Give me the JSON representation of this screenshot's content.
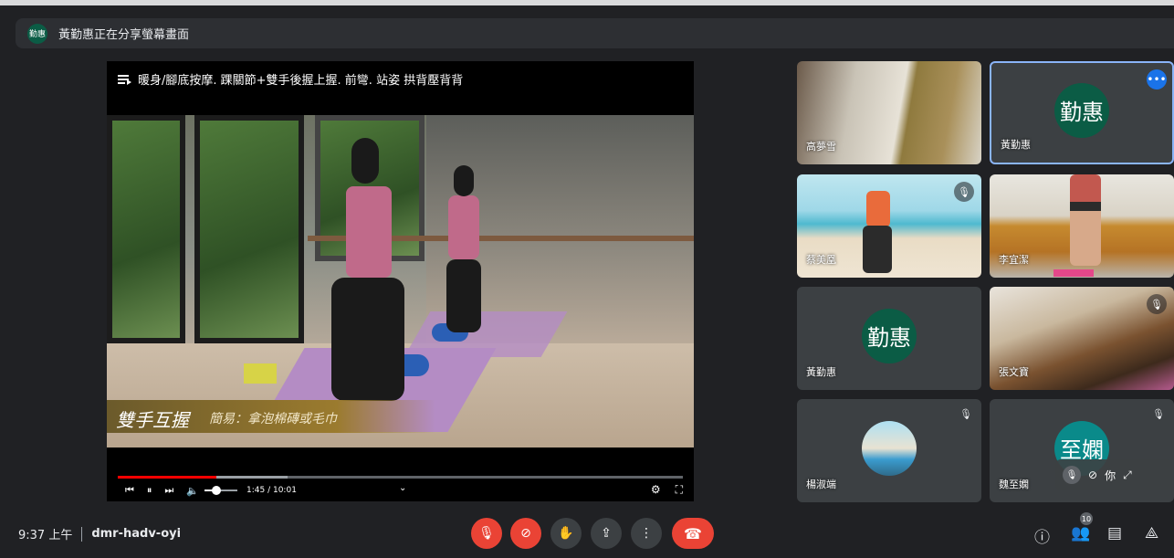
{
  "banner": {
    "avatar_text": "勤惠",
    "text": "黃勤惠正在分享螢幕畫面"
  },
  "presentation": {
    "title": "暖身/腳底按摩. 踝關節+雙手後握上握. 前彎. 站姿 拱背壓背背",
    "caption_main": "雙手互握",
    "caption_sub": "簡易：拿泡棉磚或毛巾",
    "time": "1:45 / 10:01",
    "progress": 0.175,
    "buffered": 0.3,
    "volume": 0.35,
    "icons": [
      "playlist-icon",
      "previous-icon",
      "pause-icon",
      "next-icon",
      "volume-icon",
      "chevron-down-icon",
      "settings-icon",
      "exit-fullscreen-icon"
    ]
  },
  "participants": [
    {
      "name": "高夢雪",
      "type": "video",
      "muted": false
    },
    {
      "name": "黃勤惠",
      "type": "avatar",
      "avatar_text": "勤惠",
      "avatar_color": "#0b5c45",
      "active": true,
      "more": true
    },
    {
      "name": "蔡美凰",
      "type": "video",
      "muted": true
    },
    {
      "name": "李宜潔",
      "type": "video",
      "muted": false
    },
    {
      "name": "黃勤惠",
      "type": "avatar",
      "avatar_text": "勤惠",
      "avatar_color": "#0b5c45",
      "muted": false
    },
    {
      "name": "張文寶",
      "type": "video",
      "muted": true
    },
    {
      "name": "楊淑端",
      "type": "photo",
      "muted": true
    },
    {
      "name": "魏至嫻",
      "type": "avatar",
      "avatar_text": "至嫻",
      "avatar_color": "#0a8a8a",
      "muted": true,
      "self": true,
      "self_label": "你"
    }
  ],
  "bottom_bar": {
    "time": "9:37 上午",
    "meeting_code": "dmr-hadv-oyi",
    "people_count": "10"
  },
  "colors": {
    "background": "#202124",
    "danger": "#ea4335",
    "accent": "#8ab4f8",
    "more_blue": "#1a73e8"
  }
}
